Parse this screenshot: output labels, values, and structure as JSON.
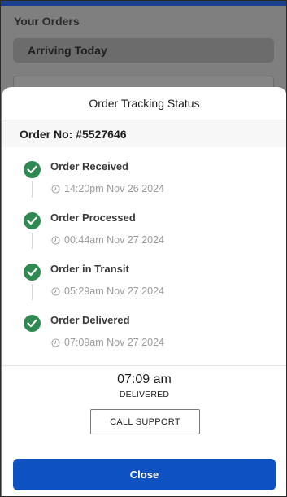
{
  "background": {
    "title": "Your Orders",
    "arriving_label": "Arriving Today"
  },
  "modal": {
    "title": "Order Tracking Status",
    "order_number": "Order No: #5527646",
    "steps": [
      {
        "label": "Order Received",
        "time": "14:20pm Nov 26 2024"
      },
      {
        "label": "Order Processed",
        "time": "00:44am Nov 27 2024"
      },
      {
        "label": "Order in Transit",
        "time": "05:29am Nov 27 2024"
      },
      {
        "label": "Order Delivered",
        "time": "07:09am Nov 27 2024"
      }
    ],
    "current_time": "07:09 am",
    "current_status": "DELIVERED",
    "support_button": "CALL SUPPORT",
    "close_button": "Close"
  },
  "colors": {
    "accent_blue": "#0e52c1",
    "check_green": "#2e8a51"
  },
  "icons": {
    "step": "check-circle-icon",
    "time": "clock-icon"
  }
}
